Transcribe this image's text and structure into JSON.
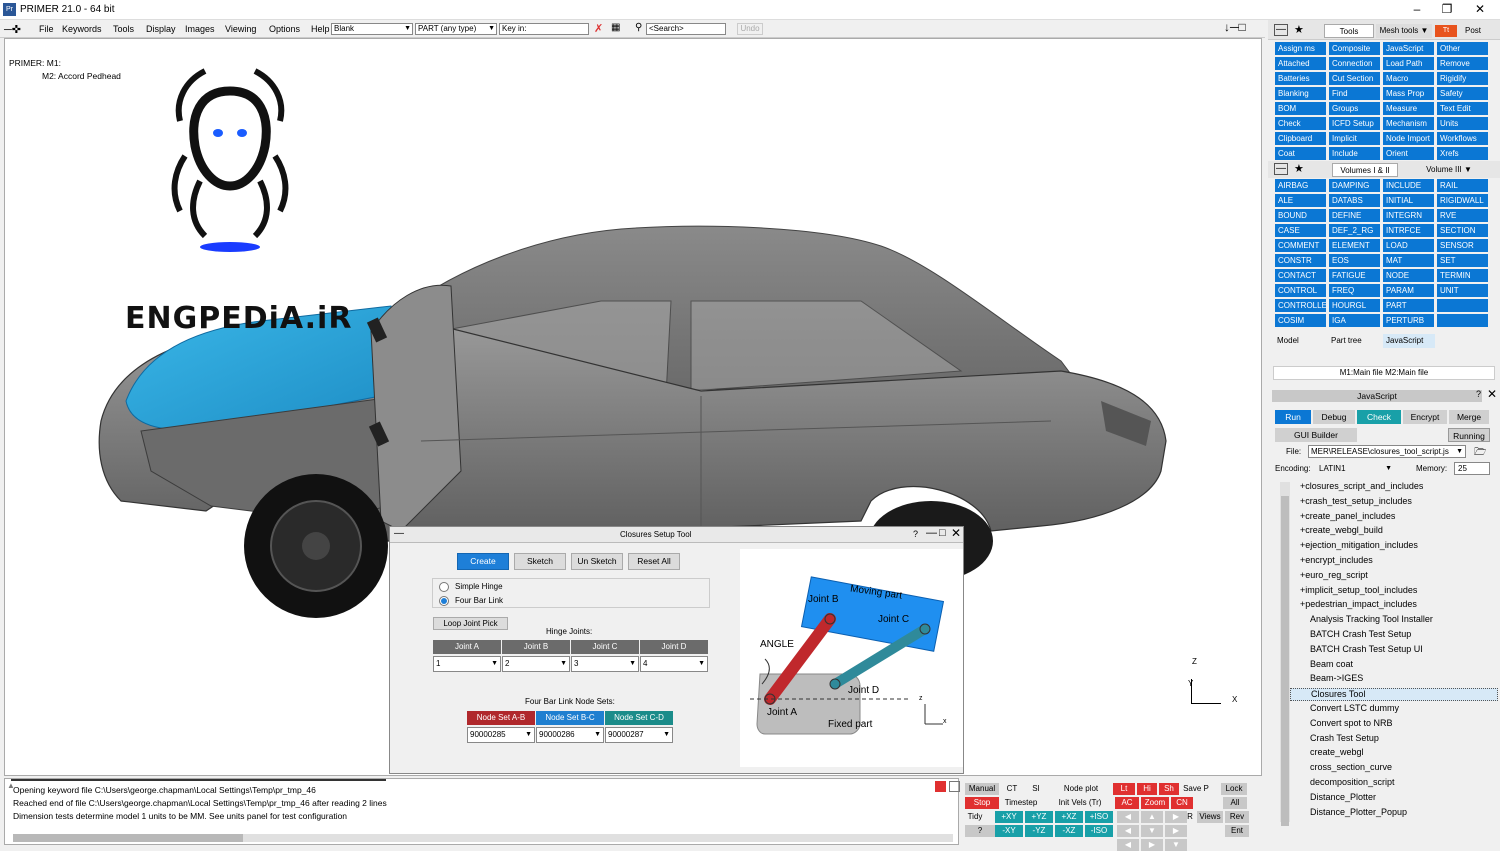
{
  "window": {
    "title": "PRIMER 21.0 - 64 bit",
    "app_icon": "Pr"
  },
  "menu": {
    "items": [
      "File",
      "Keywords",
      "Tools",
      "Display",
      "Images",
      "Viewing",
      "Options",
      "Help"
    ],
    "blank_select": "Blank",
    "part_select": "PART  (any type)",
    "key_in": "Key in:",
    "search": "<Search>",
    "undo": "Undo"
  },
  "viewport": {
    "model_line1": "PRIMER: M1:",
    "model_line2": "M2: Accord Pedhead",
    "watermark": "ENGPEDiA.iR",
    "axis_z": "Z",
    "axis_y": "Y",
    "axis_x": "X"
  },
  "dialog": {
    "title": "Closures Setup Tool",
    "buttons": [
      "Create",
      "Sketch",
      "Un Sketch",
      "Reset All"
    ],
    "radio_simple": "Simple Hinge",
    "radio_fourbar": "Four Bar Link",
    "loop_joint_pick": "Loop Joint Pick",
    "hinge_joints_label": "Hinge Joints:",
    "joint_headers": [
      "Joint A",
      "Joint B",
      "Joint C",
      "Joint D"
    ],
    "joint_values": [
      "1",
      "2",
      "3",
      "4"
    ],
    "node_sets_label": "Four Bar Link Node Sets:",
    "node_headers": [
      "Node Set A-B",
      "Node Set B-C",
      "Node Set C-D"
    ],
    "node_values": [
      "90000285",
      "90000286",
      "90000287"
    ],
    "diagram": {
      "moving_part": "Moving part",
      "fixed_part": "Fixed part",
      "angle": "ANGLE",
      "joint_a": "Joint A",
      "joint_b": "Joint B",
      "joint_c": "Joint C",
      "joint_d": "Joint D",
      "z": "z",
      "x": "x"
    }
  },
  "tools_panel": {
    "tabs": [
      "Tools",
      "Mesh tools",
      "Post"
    ],
    "grid": [
      [
        "Assign ms",
        "Composite",
        "JavaScript",
        "Other"
      ],
      [
        "Attached",
        "Connection",
        "Load Path",
        "Remove"
      ],
      [
        "Batteries",
        "Cut Section",
        "Macro",
        "Rigidify"
      ],
      [
        "Blanking",
        "Find",
        "Mass Prop",
        "Safety"
      ],
      [
        "BOM",
        "Groups",
        "Measure",
        "Text Edit"
      ],
      [
        "Check",
        "ICFD Setup",
        "Mechanism",
        "Units"
      ],
      [
        "Clipboard",
        "Implicit",
        "Node Import",
        "Workflows"
      ],
      [
        "Coat",
        "Include",
        "Orient",
        "Xrefs"
      ]
    ]
  },
  "keywords_panel": {
    "tabs": [
      "Volumes I & II",
      "Volume III"
    ],
    "grid": [
      [
        "AIRBAG",
        "DAMPING",
        "INCLUDE",
        "RAIL"
      ],
      [
        "ALE",
        "DATABS",
        "INITIAL",
        "RIGIDWALL"
      ],
      [
        "BOUND",
        "DEFINE",
        "INTEGRN",
        "RVE"
      ],
      [
        "CASE",
        "DEF_2_RG",
        "INTRFCE",
        "SECTION"
      ],
      [
        "COMMENT",
        "ELEMENT",
        "LOAD",
        "SENSOR"
      ],
      [
        "CONSTR",
        "EOS",
        "MAT",
        "SET"
      ],
      [
        "CONTACT",
        "FATIGUE",
        "NODE",
        "TERMIN"
      ],
      [
        "CONTROL",
        "FREQ",
        "PARAM",
        "UNIT"
      ],
      [
        "CONTROLLE",
        "HOURGL",
        "PART",
        ""
      ],
      [
        "COSIM",
        "IGA",
        "PERTURB",
        ""
      ]
    ],
    "bottom_tabs": [
      "Model",
      "Part tree",
      "JavaScript"
    ],
    "main_file": "M1:Main file M2:Main file"
  },
  "js_panel": {
    "title": "JavaScript",
    "buttons": [
      "Run",
      "Debug",
      "Check",
      "Encrypt",
      "Merge"
    ],
    "gui_builder": "GUI Builder",
    "running": "Running",
    "file_label": "File:",
    "file_value": "MER\\RELEASE\\closures_tool_script.js",
    "encoding_label": "Encoding:",
    "encoding_value": "LATIN1",
    "memory_label": "Memory:",
    "memory_value": "25",
    "tree_folders": [
      "closures_script_and_includes",
      "crash_test_setup_includes",
      "create_panel_includes",
      "create_webgl_build",
      "ejection_mitigation_includes",
      "encrypt_includes",
      "euro_reg_script",
      "implicit_setup_tool_includes",
      "pedestrian_impact_includes"
    ],
    "tree_items": [
      "Analysis Tracking Tool Installer",
      "BATCH Crash Test Setup",
      "BATCH Crash Test Setup UI",
      "Beam coat",
      "Beam->IGES",
      "Closures Tool",
      "Convert LSTC dummy",
      "Convert spot to NRB",
      "Crash Test Setup",
      "create_webgl",
      "cross_section_curve",
      "decomposition_script",
      "Distance_Plotter",
      "Distance_Plotter_Popup"
    ]
  },
  "console": {
    "lines": [
      "Opening keyword file C:\\Users\\george.chapman\\Local Settings\\Temp\\pr_tmp_46",
      "Reached end of file C:\\Users\\george.chapman\\Local Settings\\Temp\\pr_tmp_46 after reading 2 lines",
      "Dimension tests determine model 1 units to be MM. See units panel for test configuration"
    ]
  },
  "controls": {
    "row1": [
      "Manual",
      "CT",
      "SI",
      "Node plot",
      "Lt",
      "Hi",
      "Sh",
      "Save P",
      "Lock"
    ],
    "row2": [
      "Stop",
      "Timestep",
      "Init Vels (Tr)",
      "AC",
      "Zoom",
      "CN",
      "All"
    ],
    "row3": [
      "Tidy",
      "+XY",
      "+YZ",
      "+XZ",
      "+ISO",
      "R",
      "Views",
      "Rev"
    ],
    "row4": [
      "?",
      "-XY",
      "-YZ",
      "-XZ",
      "-ISO",
      "Ent"
    ]
  },
  "colors": {
    "accent": "#0b77d4",
    "hood": "#2aa6d8",
    "car": "#7d7d7d"
  }
}
